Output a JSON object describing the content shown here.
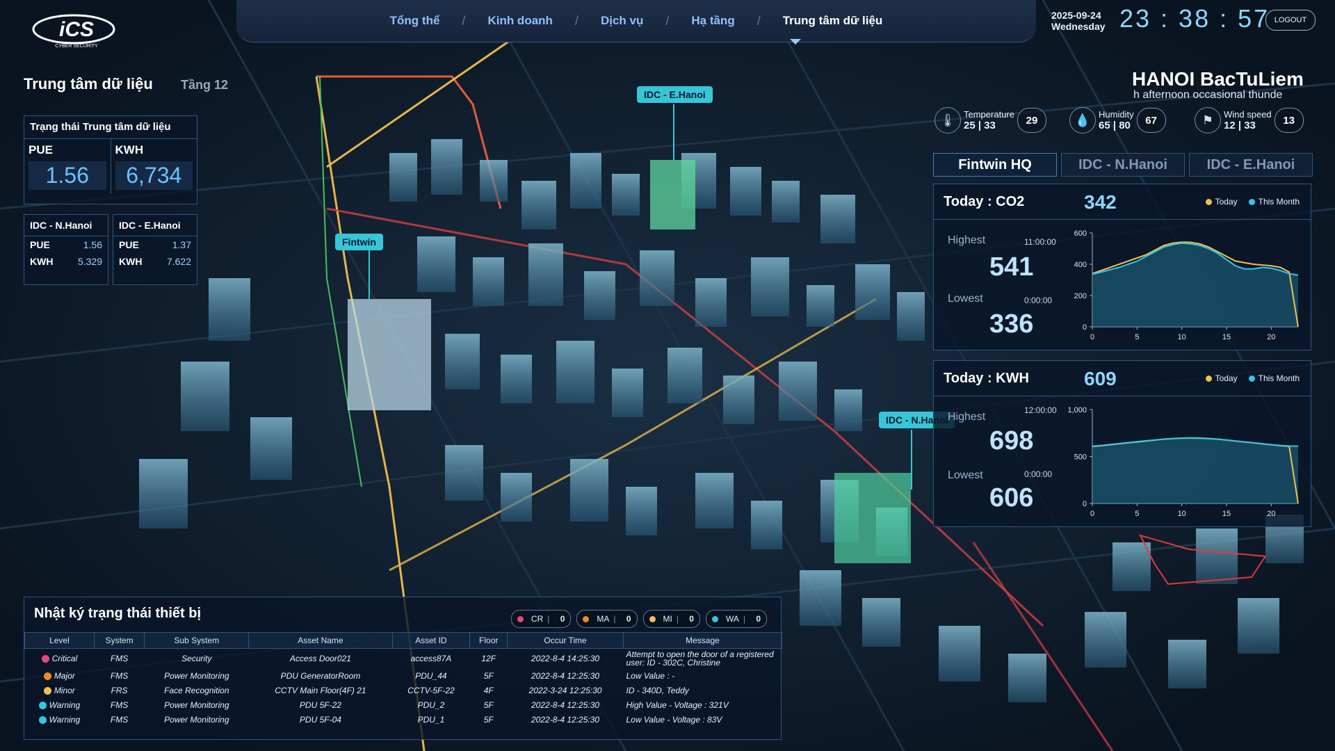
{
  "brand": {
    "logo_text": "iCS",
    "logo_sub": "CYBER SECURITY"
  },
  "nav": {
    "items": [
      {
        "label": "Tổng thể"
      },
      {
        "label": "Kinh doanh"
      },
      {
        "label": "Dịch vụ"
      },
      {
        "label": "Hạ tầng"
      },
      {
        "label": "Trung tâm dữ liệu",
        "active": true
      }
    ]
  },
  "datetime": {
    "date": "2025-09-24",
    "weekday": "Wednesday",
    "time": "23 : 38 : 57"
  },
  "logout_label": "LOGOUT",
  "section": {
    "title": "Trung tâm dữ liệu",
    "floor": "Tầng 12"
  },
  "status": {
    "title": "Trạng thái Trung tâm dữ liệu",
    "pue_label": "PUE",
    "pue": "1.56",
    "kwh_label": "KWH",
    "kwh": "6,734"
  },
  "sites": [
    {
      "name": "IDC - N.Hanoi",
      "pue_label": "PUE",
      "pue": "1.56",
      "kwh_label": "KWH",
      "kwh": "5.329"
    },
    {
      "name": "IDC - E.Hanoi",
      "pue_label": "PUE",
      "pue": "1.37",
      "kwh_label": "KWH",
      "kwh": "7.622"
    }
  ],
  "map_labels": {
    "e_hanoi": "IDC - E.Hanoi",
    "fintwin": "Fintwin",
    "n_hanoi": "IDC - N.Hanoi"
  },
  "weather": {
    "city": "HANOI BacTuLiem",
    "desc": "h afternoon occasional thunde",
    "temperature": {
      "label": "Temperature",
      "range": "25 | 33",
      "value": "29",
      "icon": "thermometer-icon"
    },
    "humidity": {
      "label": "Humidity",
      "range": "65 | 80",
      "value": "67",
      "icon": "droplet-icon"
    },
    "wind": {
      "label": "Wind speed",
      "range": "12 | 33",
      "value": "13",
      "icon": "wind-flag-icon"
    }
  },
  "tabs": [
    {
      "label": "Fintwin HQ",
      "active": true
    },
    {
      "label": "IDC - N.Hanoi"
    },
    {
      "label": "IDC - E.Hanoi"
    }
  ],
  "legend": {
    "today": "Today",
    "month": "This Month",
    "today_color": "#f2c14e",
    "month_color": "#34c6e8"
  },
  "co2": {
    "title": "Today : CO2",
    "value": "342",
    "highest_label": "Highest",
    "highest_time": "11:00:00",
    "highest": "541",
    "lowest_label": "Lowest",
    "lowest_time": "0:00:00",
    "lowest": "336"
  },
  "kwh": {
    "title": "Today : KWH",
    "value": "609",
    "highest_label": "Highest",
    "highest_time": "12:00:00",
    "highest": "698",
    "lowest_label": "Lowest",
    "lowest_time": "0:00:00",
    "lowest": "606"
  },
  "chart_data": [
    {
      "type": "area",
      "title": "",
      "x": [
        0,
        1,
        2,
        3,
        4,
        5,
        6,
        7,
        8,
        9,
        10,
        11,
        12,
        13,
        14,
        15,
        16,
        17,
        18,
        19,
        20,
        21,
        22,
        23
      ],
      "xticks": [
        0,
        5,
        10,
        15,
        20
      ],
      "yticks": [
        "0",
        "200",
        "400",
        "600"
      ],
      "ylim": [
        0,
        600
      ],
      "xlim": [
        0,
        23
      ],
      "series": [
        {
          "name": "Today",
          "color": "#f2c14e",
          "values": [
            340,
            360,
            380,
            400,
            420,
            440,
            460,
            490,
            520,
            535,
            541,
            540,
            530,
            510,
            480,
            450,
            420,
            410,
            400,
            395,
            390,
            380,
            350,
            0
          ]
        },
        {
          "name": "This Month",
          "color": "#34c6e8",
          "values": [
            336,
            350,
            365,
            380,
            400,
            420,
            450,
            480,
            510,
            525,
            535,
            530,
            520,
            500,
            470,
            430,
            390,
            370,
            370,
            380,
            375,
            360,
            340,
            330
          ]
        }
      ]
    },
    {
      "type": "area",
      "title": "",
      "x": [
        0,
        1,
        2,
        3,
        4,
        5,
        6,
        7,
        8,
        9,
        10,
        11,
        12,
        13,
        14,
        15,
        16,
        17,
        18,
        19,
        20,
        21,
        22,
        23
      ],
      "xticks": [
        0,
        5,
        10,
        15,
        20
      ],
      "yticks": [
        "0",
        "500",
        "1,000"
      ],
      "ylim": [
        0,
        1000
      ],
      "xlim": [
        0,
        23
      ],
      "series": [
        {
          "name": "Today",
          "color": "#f2c14e",
          "values": [
            606,
            615,
            625,
            635,
            645,
            655,
            665,
            675,
            685,
            692,
            696,
            698,
            697,
            692,
            685,
            675,
            665,
            655,
            645,
            635,
            625,
            615,
            608,
            0
          ]
        },
        {
          "name": "This Month",
          "color": "#34c6e8",
          "values": [
            610,
            618,
            628,
            638,
            648,
            658,
            668,
            676,
            684,
            690,
            694,
            695,
            694,
            690,
            684,
            676,
            666,
            656,
            646,
            636,
            626,
            618,
            612,
            610
          ]
        }
      ]
    }
  ],
  "log": {
    "title": "Nhật ký trạng thái thiết bị",
    "badges": [
      {
        "code": "CR",
        "count": "0",
        "color": "#e8467c"
      },
      {
        "code": "MA",
        "count": "0",
        "color": "#f08a24"
      },
      {
        "code": "MI",
        "count": "0",
        "color": "#f2c14e"
      },
      {
        "code": "WA",
        "count": "0",
        "color": "#34c6e8"
      }
    ],
    "columns": [
      "Level",
      "System",
      "Sub System",
      "Asset Name",
      "Asset ID",
      "Floor",
      "Occur Time",
      "Message"
    ],
    "rows": [
      {
        "level": "Critical",
        "color": "#e8467c",
        "system": "FMS",
        "sub": "Security",
        "asset": "Access Door021",
        "id": "access87A",
        "floor": "12F",
        "time": "2022-8-4 14:25:30",
        "msg": "Attempt to open the door of a registered user: ID - 302C, Christine"
      },
      {
        "level": "Major",
        "color": "#f08a24",
        "system": "FMS",
        "sub": "Power Monitoring",
        "asset": "PDU GeneratorRoom",
        "id": "PDU_44",
        "floor": "5F",
        "time": "2022-8-4 12:25:30",
        "msg": "Low Value : -"
      },
      {
        "level": "Minor",
        "color": "#f2c14e",
        "system": "FRS",
        "sub": "Face Recognition",
        "asset": "CCTV Main Floor(4F) 21",
        "id": "CCTV-5F-22",
        "floor": "4F",
        "time": "2022-3-24 12:25:30",
        "msg": "ID - 340D, Teddy"
      },
      {
        "level": "Warning",
        "color": "#34c6e8",
        "system": "FMS",
        "sub": "Power Monitoring",
        "asset": "PDU 5F-22",
        "id": "PDU_2",
        "floor": "5F",
        "time": "2022-8-4 12:25:30",
        "msg": "High Value - Voltage : 321V"
      },
      {
        "level": "Warning",
        "color": "#34c6e8",
        "system": "FMS",
        "sub": "Power Monitoring",
        "asset": "PDU 5F-04",
        "id": "PDU_1",
        "floor": "5F",
        "time": "2022-8-4 12:25:30",
        "msg": "Low Value - Voltage : 83V"
      }
    ]
  }
}
